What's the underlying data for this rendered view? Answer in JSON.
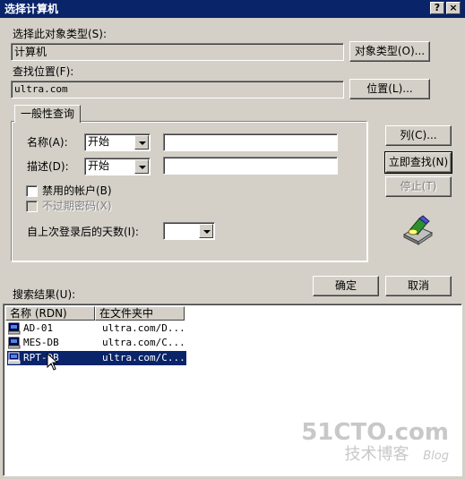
{
  "window": {
    "title": "选择计算机",
    "help_label": "?",
    "close_label": "×"
  },
  "object_type": {
    "label": "选择此对象类型(S):",
    "value": "计算机",
    "button": "对象类型(O)..."
  },
  "location": {
    "label": "查找位置(F):",
    "value": "ultra.com",
    "button": "位置(L)..."
  },
  "query": {
    "tab_label": "一般性查询",
    "name_label": "名称(A):",
    "name_mode": "开始",
    "name_value": "",
    "desc_label": "描述(D):",
    "desc_mode": "开始",
    "desc_value": "",
    "disabled_accounts_label": "禁用的帐户(B)",
    "non_expiring_label": "不过期密码(X)",
    "days_label": "自上次登录后的天数(I):",
    "days_value": ""
  },
  "side_buttons": {
    "columns": "列(C)...",
    "find_now": "立即查找(N)",
    "stop": "停止(T)"
  },
  "actions": {
    "ok": "确定",
    "cancel": "取消"
  },
  "results": {
    "label": "搜索结果(U):",
    "columns": [
      "名称 (RDN)",
      "在文件夹中"
    ],
    "rows": [
      {
        "name": "AD-01",
        "folder": "ultra.com/D..."
      },
      {
        "name": "MES-DB",
        "folder": "ultra.com/C..."
      },
      {
        "name": "RPT-DB",
        "folder": "ultra.com/C..."
      }
    ]
  },
  "watermark": {
    "line1": "51CTO.com",
    "line2": "技术博客",
    "line3": "Blog"
  },
  "colors": {
    "titlebar": "#0a246a",
    "face": "#d4d0c8",
    "selection": "#0a246a"
  }
}
